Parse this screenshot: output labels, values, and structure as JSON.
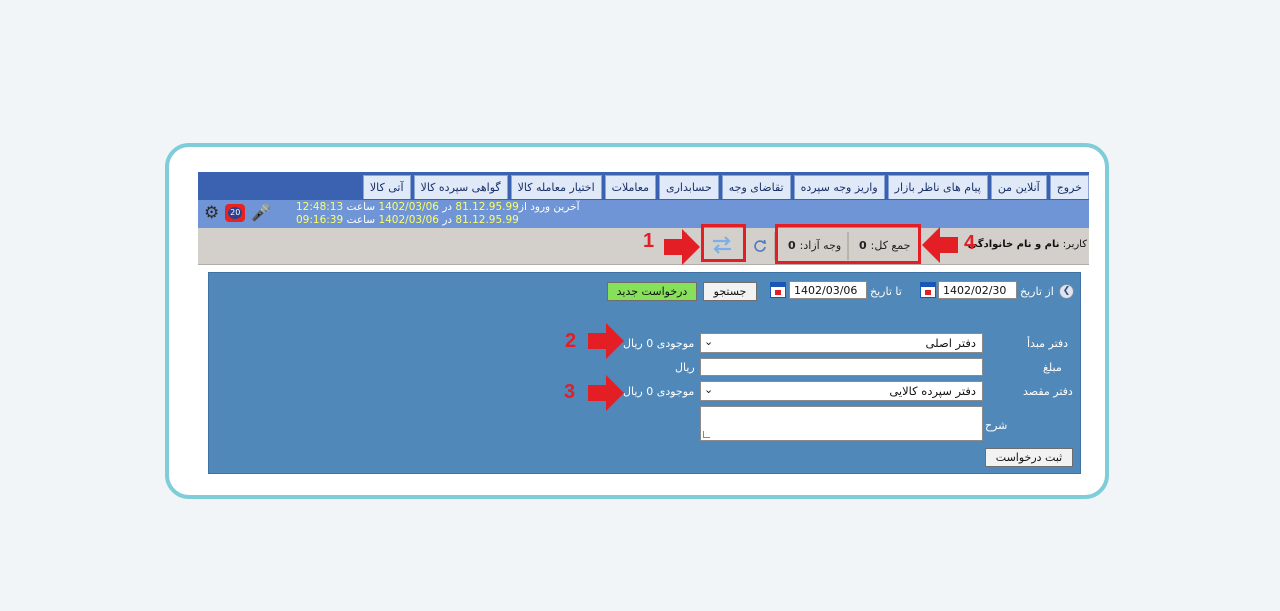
{
  "menu": [
    "آتی کالا",
    "گواهی سپرده کالا",
    "اختیار معامله کالا",
    "معاملات",
    "حسابداری",
    "تقاضای وجه",
    "واریز وجه سپرده",
    "پیام های ناظر بازار",
    "آنلاین من",
    "خروج"
  ],
  "login": {
    "line1_prefix": "آخرین ورود از",
    "line1_ip": "81.12.95.99",
    "line1_mid": "در",
    "line1_date": "1402/03/06",
    "line1_time_label": "ساعت",
    "line1_time": "12:48:13",
    "line2_ip": "81.12.95.99",
    "line2_mid": "در",
    "line2_date": "1402/03/06",
    "line2_time_label": "ساعت",
    "line2_time": "09:16:39"
  },
  "notifications": {
    "count": "20"
  },
  "status": {
    "user_label": "کاربر:",
    "user_name": "نام و نام خانوادگی",
    "total_label": "جمع کل:",
    "total_value": "0",
    "free_label": "وجه آزاد:",
    "free_value": "0"
  },
  "callouts": [
    "1",
    "2",
    "3",
    "4"
  ],
  "filter": {
    "from_label": "از تاریخ",
    "from_value": "1402/02/30",
    "to_label": "تا تاریخ",
    "to_value": "1402/03/06",
    "search_label": "جستجو",
    "new_request_label": "درخواست جدید"
  },
  "form": {
    "source_label": "دفتر مبدأ",
    "source_value": "دفتر اصلی",
    "source_balance": "موجودی 0 ریال",
    "amount_label": "مبلغ",
    "amount_unit": "ریال",
    "amount_value": "",
    "dest_label": "دفتر مقصد",
    "dest_value": "دفتر سپرده کالایی",
    "dest_balance": "موجودی 0 ریال",
    "desc_label": "شرح",
    "submit_label": "ثبت درخواست"
  },
  "colors": {
    "menubar": "#3b62b0",
    "infobar": "#6f95d6",
    "highlight": "#ffff66",
    "panel": "#5088b9",
    "callout_red": "#e31e24",
    "new_request_button": "#86e05a",
    "frame_border": "#7fcdd8"
  }
}
